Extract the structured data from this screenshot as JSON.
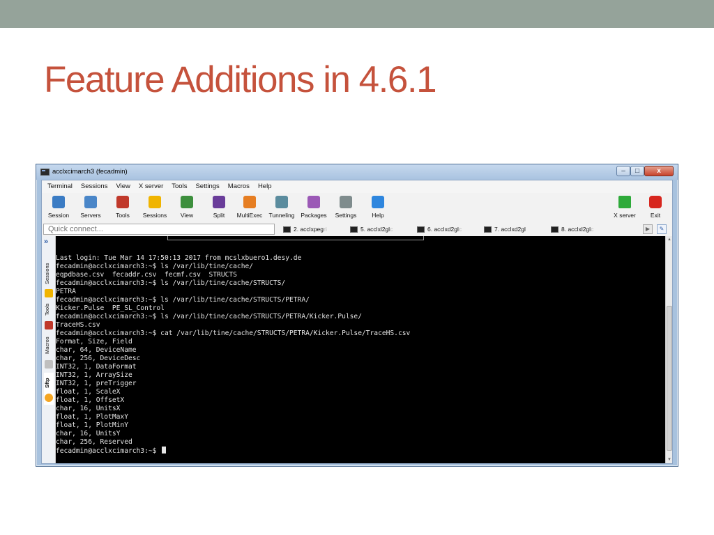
{
  "slide": {
    "title": "Feature Additions in 4.6.1"
  },
  "window": {
    "title": "acclxcimarch3 (fecadmin)",
    "controls": {
      "minimize": "–",
      "maximize": "□",
      "close": "x"
    }
  },
  "menu": [
    "Terminal",
    "Sessions",
    "View",
    "X server",
    "Tools",
    "Settings",
    "Macros",
    "Help"
  ],
  "toolbar": {
    "items": [
      {
        "label": "Session",
        "icon": "session-icon",
        "color": "#3b7cc4"
      },
      {
        "label": "Servers",
        "icon": "servers-icon",
        "color": "#4a86c8"
      },
      {
        "label": "Tools",
        "icon": "tools-icon",
        "color": "#c0392b"
      },
      {
        "label": "Sessions",
        "icon": "star-icon",
        "color": "#f0b400"
      },
      {
        "label": "View",
        "icon": "view-icon",
        "color": "#3d8f3d"
      },
      {
        "label": "Split",
        "icon": "split-icon",
        "color": "#6a3d9a"
      },
      {
        "label": "MultiExec",
        "icon": "multiexec-icon",
        "color": "#e67e22"
      },
      {
        "label": "Tunneling",
        "icon": "tunneling-icon",
        "color": "#5b8c9e"
      },
      {
        "label": "Packages",
        "icon": "packages-icon",
        "color": "#9b59b6"
      },
      {
        "label": "Settings",
        "icon": "settings-icon",
        "color": "#7f8c8d"
      },
      {
        "label": "Help",
        "icon": "help-icon",
        "color": "#2e86de"
      }
    ],
    "right": [
      {
        "label": "X server",
        "icon": "x-server-icon",
        "color": "#2eaa3a"
      },
      {
        "label": "Exit",
        "icon": "exit-icon",
        "color": "#d7261e"
      }
    ]
  },
  "quick_connect": {
    "placeholder": "Quick connect..."
  },
  "tabs": [
    {
      "label": "2. acclxpeg",
      "faded": "ri"
    },
    {
      "label": "5. acclxl2gl",
      "faded": "c"
    },
    {
      "label": "6. acclxd2gl",
      "faded": "c"
    },
    {
      "label": "7. acclxd2gl",
      "faded": ""
    },
    {
      "label": "8. acclxl2gl",
      "faded": "c"
    }
  ],
  "sidebar": [
    "Sessions",
    "Tools",
    "Macros",
    "Sftp"
  ],
  "terminal": {
    "lines": [
      "Last login: Tue Mar 14 17:50:13 2017 from mcslxbuero1.desy.de",
      "fecadmin@acclxcimarch3:~$ ls /var/lib/tine/cache/",
      "eqpdbase.csv  fecaddr.csv  fecmf.csv  STRUCTS",
      "fecadmin@acclxcimarch3:~$ ls /var/lib/tine/cache/STRUCTS/",
      "PETRA",
      "fecadmin@acclxcimarch3:~$ ls /var/lib/tine/cache/STRUCTS/PETRA/",
      "Kicker.Pulse  PE_SL_Control",
      "fecadmin@acclxcimarch3:~$ ls /var/lib/tine/cache/STRUCTS/PETRA/Kicker.Pulse/",
      "TraceHS.csv",
      "fecadmin@acclxcimarch3:~$ cat /var/lib/tine/cache/STRUCTS/PETRA/Kicker.Pulse/TraceHS.csv",
      "Format, Size, Field",
      "char, 64, DeviceName",
      "char, 256, DeviceDesc",
      "INT32, 1, DataFormat",
      "INT32, 1, ArraySize",
      "INT32, 1, preTrigger",
      "float, 1, ScaleX",
      "float, 1, OffsetX",
      "char, 16, UnitsX",
      "float, 1, PlotMaxY",
      "float, 1, PlotMinY",
      "char, 16, UnitsY",
      "char, 256, Reserved",
      "fecadmin@acclxcimarch3:~$ "
    ]
  }
}
